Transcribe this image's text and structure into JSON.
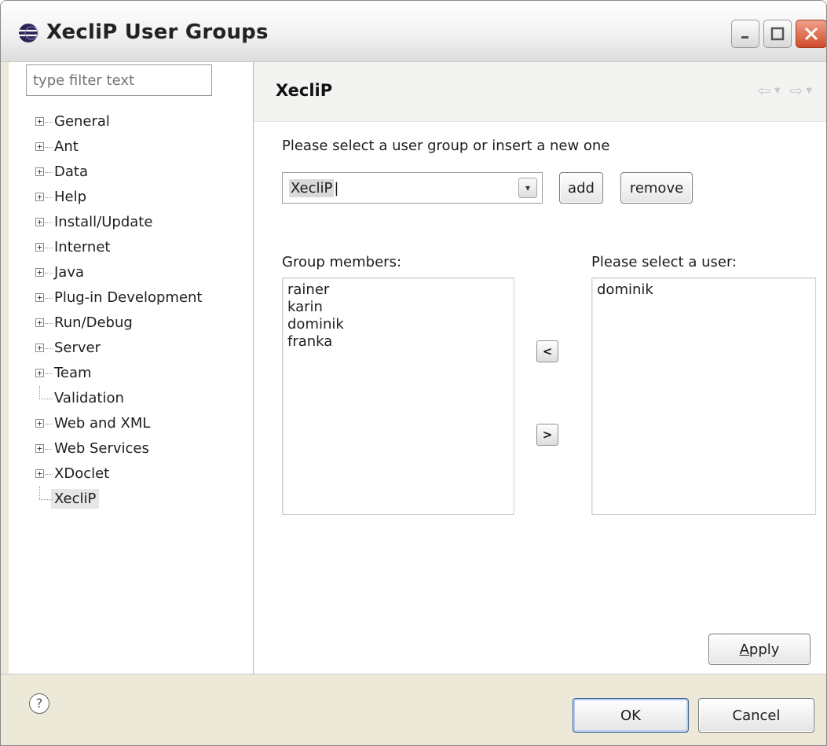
{
  "window": {
    "title": "XecliP User Groups",
    "icon": "eclipse-icon",
    "controls": [
      "minimize",
      "maximize",
      "close"
    ]
  },
  "sidebar": {
    "filter_placeholder": "type filter text",
    "items": [
      {
        "label": "General",
        "expandable": true
      },
      {
        "label": "Ant",
        "expandable": true
      },
      {
        "label": "Data",
        "expandable": true
      },
      {
        "label": "Help",
        "expandable": true
      },
      {
        "label": "Install/Update",
        "expandable": true
      },
      {
        "label": "Internet",
        "expandable": true
      },
      {
        "label": "Java",
        "expandable": true
      },
      {
        "label": "Plug-in Development",
        "expandable": true
      },
      {
        "label": "Run/Debug",
        "expandable": true
      },
      {
        "label": "Server",
        "expandable": true
      },
      {
        "label": "Team",
        "expandable": true
      },
      {
        "label": "Validation",
        "expandable": false
      },
      {
        "label": "Web and XML",
        "expandable": true
      },
      {
        "label": "Web Services",
        "expandable": true
      },
      {
        "label": "XDoclet",
        "expandable": true
      },
      {
        "label": "XecliP",
        "expandable": false,
        "selected": true
      }
    ]
  },
  "main": {
    "title": "XecliP",
    "prompt": "Please select a user group or insert a new one",
    "group_combo_value": "XecliP",
    "add_label": "add",
    "remove_label": "remove",
    "members_label": "Group members:",
    "members": [
      "rainer",
      "karin",
      "dominik",
      "franka"
    ],
    "users_label": "Please select a user:",
    "users": [
      "dominik"
    ],
    "move_left_label": "<",
    "move_right_label": ">",
    "apply_label_prefix": "",
    "apply_label_mnemonic": "A",
    "apply_label_rest": "pply"
  },
  "footer": {
    "ok_label": "OK",
    "cancel_label": "Cancel",
    "help_glyph": "?"
  },
  "colors": {
    "window_bg": "#ece9d8",
    "close_button": "#d04a2a",
    "ok_border": "#3d5f93"
  }
}
